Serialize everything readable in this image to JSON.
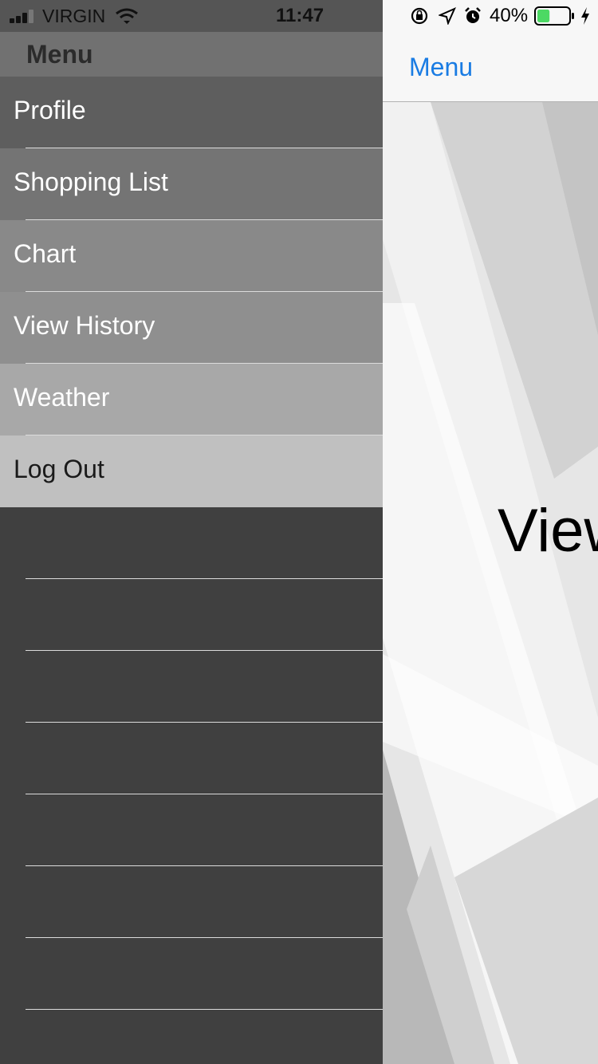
{
  "status_bar": {
    "carrier": "VIRGIN",
    "time": "11:47",
    "battery_percent": "40%",
    "battery_level": 0.4
  },
  "drawer": {
    "title": "Menu",
    "items": [
      {
        "label": "Profile",
        "bg": "#5e5e5e",
        "fg": "#ffffff"
      },
      {
        "label": "Shopping List",
        "bg": "#747474",
        "fg": "#ffffff"
      },
      {
        "label": "Chart",
        "bg": "#898989",
        "fg": "#ffffff"
      },
      {
        "label": "View History",
        "bg": "#8f8f8f",
        "fg": "#ffffff"
      },
      {
        "label": "Weather",
        "bg": "#a8a8a8",
        "fg": "#ffffff"
      },
      {
        "label": "Log Out",
        "bg": "#c0c0c0",
        "fg": "#1a1a1a"
      }
    ],
    "empty_bg": "#404040"
  },
  "main": {
    "nav_button": "Menu",
    "content_text": "View"
  },
  "colors": {
    "accent": "#1a7ce3",
    "battery_fill": "#4cd964"
  }
}
